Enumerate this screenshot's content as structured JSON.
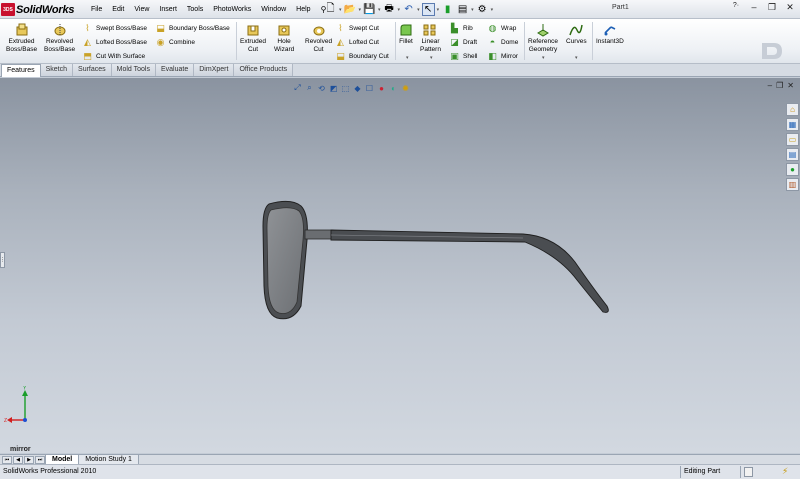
{
  "app": {
    "logo_badge": "3DS",
    "name": "SolidWorks",
    "document_title": "Part1"
  },
  "menu": [
    "File",
    "Edit",
    "View",
    "Insert",
    "Tools",
    "PhotoWorks",
    "Window",
    "Help"
  ],
  "quick_access_icons": [
    "new-icon",
    "open-icon",
    "save-icon",
    "print-icon",
    "undo-icon",
    "select-icon",
    "rebuild-icon",
    "file-properties-icon",
    "options-icon"
  ],
  "command_manager": {
    "extruded_boss": "Extruded\nBoss/Base",
    "revolved_boss": "Revolved\nBoss/Base",
    "swept_boss": "Swept Boss/Base",
    "lofted_boss": "Lofted Boss/Base",
    "boundary_boss": "Boundary Boss/Base",
    "cut_with_surface": "Cut With Surface",
    "combine": "Combine",
    "extruded_cut": "Extruded\nCut",
    "hole_wizard": "Hole\nWizard",
    "revolved_cut": "Revolved\nCut",
    "swept_cut": "Swept Cut",
    "lofted_cut": "Lofted Cut",
    "boundary_cut": "Boundary Cut",
    "fillet": "Fillet",
    "linear_pattern": "Linear\nPattern",
    "rib": "Rib",
    "draft": "Draft",
    "shell": "Shell",
    "wrap": "Wrap",
    "dome": "Dome",
    "mirror": "Mirror",
    "reference_geometry": "Reference\nGeometry",
    "curves": "Curves",
    "instant3d": "Instant3D"
  },
  "tabs": [
    {
      "label": "Features",
      "active": true
    },
    {
      "label": "Sketch",
      "active": false
    },
    {
      "label": "Surfaces",
      "active": false
    },
    {
      "label": "Mold Tools",
      "active": false
    },
    {
      "label": "Evaluate",
      "active": false
    },
    {
      "label": "DimXpert",
      "active": false
    },
    {
      "label": "Office Products",
      "active": false
    }
  ],
  "viewport": {
    "heads_up_icons": [
      "zoom-to-fit-icon",
      "zoom-to-area-icon",
      "previous-view-icon",
      "section-view-icon",
      "view-orientation-icon",
      "display-style-icon",
      "hide-show-icon",
      "edit-appearance-icon",
      "apply-scene-icon",
      "view-settings-icon"
    ],
    "taskpane_icons": [
      "resources-icon",
      "design-library-icon",
      "file-explorer-icon",
      "view-palette-icon",
      "appearances-icon",
      "custom-properties-icon"
    ],
    "selected_feature": "mirror",
    "triad": {
      "y_color": "#1a9e2a",
      "x_color": "#d21f1f",
      "z_color": "#1f4fd2"
    }
  },
  "bottom_tabs": [
    {
      "label": "Model",
      "active": true
    },
    {
      "label": "Motion Study 1",
      "active": false
    }
  ],
  "status": {
    "product": "SolidWorks Professional 2010",
    "mode": "Editing Part"
  }
}
